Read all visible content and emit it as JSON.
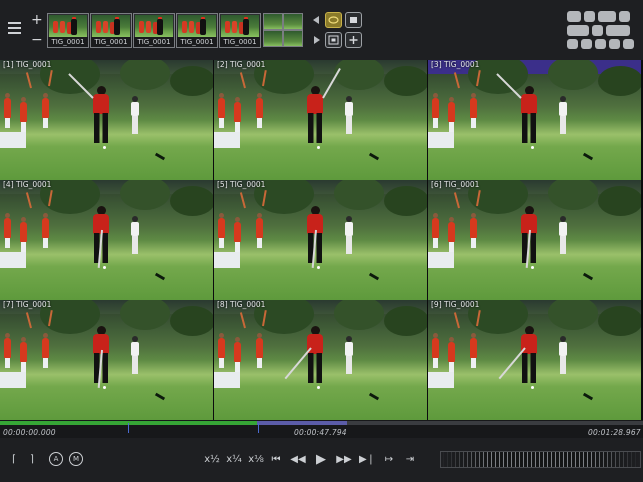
{
  "toolbar": {
    "plus": "+",
    "minus": "−",
    "clips": [
      {
        "label": "TIG_0001"
      },
      {
        "label": "TIG_0001"
      },
      {
        "label": "TIG_0001"
      },
      {
        "label": "TIG_0001"
      },
      {
        "label": "TIG_0001"
      }
    ]
  },
  "cells": [
    {
      "label": "[1] TIG_0001",
      "pose": "top"
    },
    {
      "label": "[2] TIG_0001",
      "pose": "back"
    },
    {
      "label": "[3] TIG_0001",
      "pose": "top"
    },
    {
      "label": "[4] TIG_0001",
      "pose": "address"
    },
    {
      "label": "[5] TIG_0001",
      "pose": "address"
    },
    {
      "label": "[6] TIG_0001",
      "pose": "address"
    },
    {
      "label": "[7] TIG_0001",
      "pose": "address"
    },
    {
      "label": "[8] TIG_0001",
      "pose": "takeaway"
    },
    {
      "label": "[9] TIG_0001",
      "pose": "takeaway"
    }
  ],
  "timeline": {
    "start": "00:00:00.000",
    "current": "00:00:47.794",
    "end": "00:01:28.967",
    "progress_fraction": 0.54,
    "loaded_fraction": 0.4
  },
  "transport": {
    "mark_in": "⌈",
    "mark_out": "⌉",
    "a_label": "A",
    "m_label": "M",
    "speed_half": "x½",
    "speed_quarter": "x¼",
    "speed_eighth": "x⅛",
    "step_back": "⏮",
    "rewind": "◀◀",
    "play": "▶",
    "forward": "▶▶",
    "step_forward": "▶❘",
    "jump": "↦",
    "next": "⇥"
  }
}
